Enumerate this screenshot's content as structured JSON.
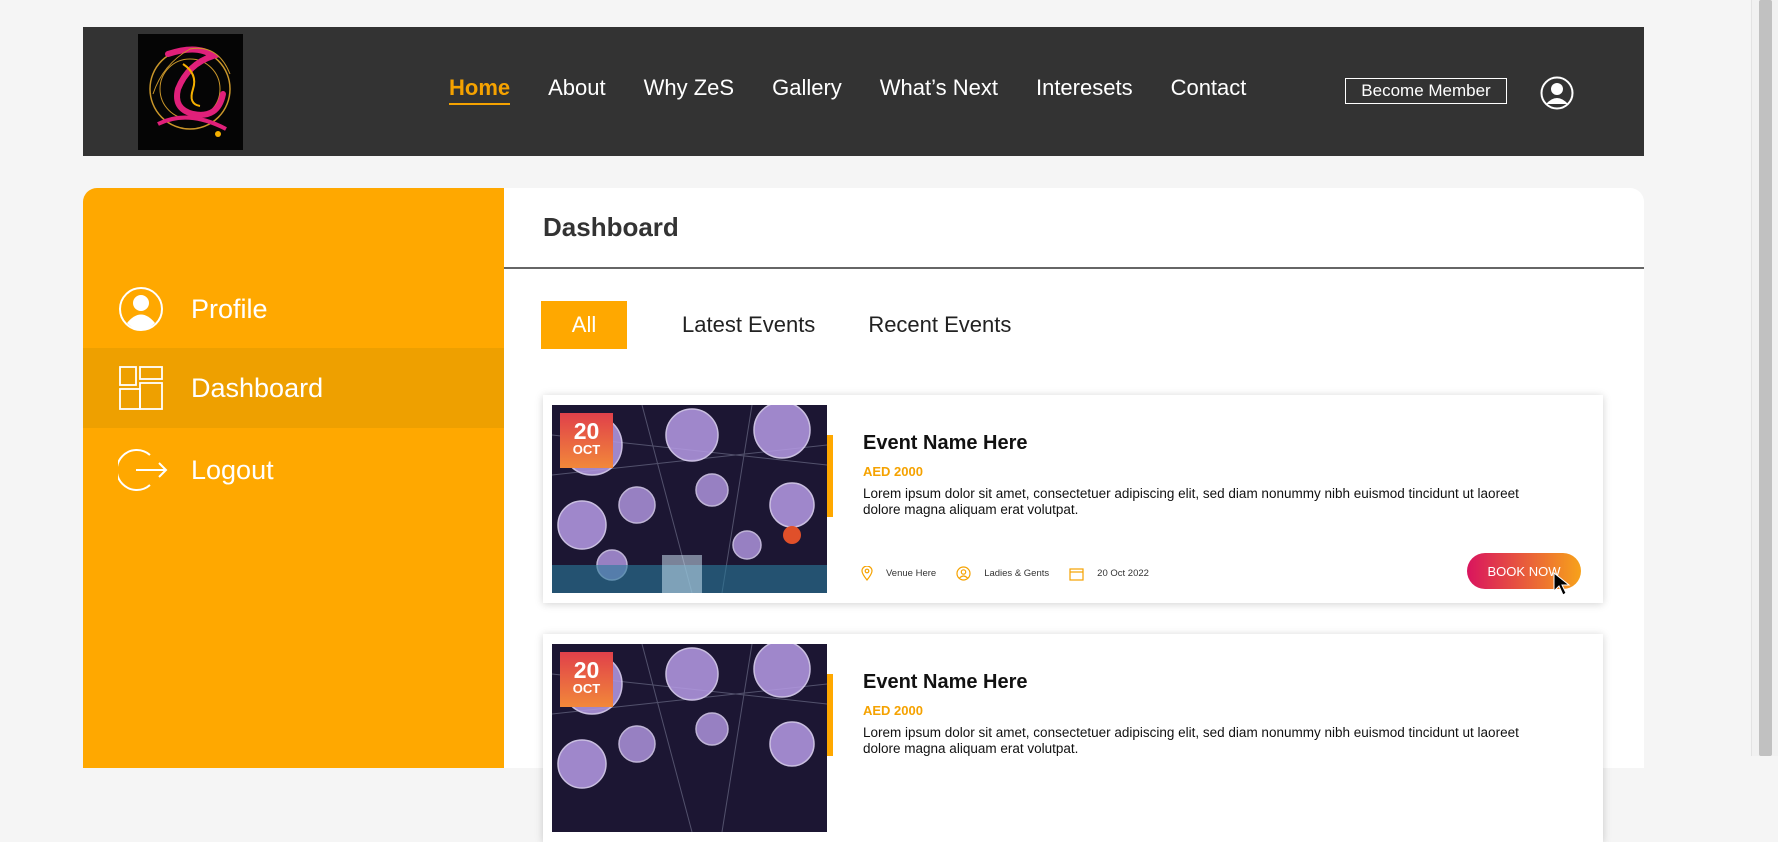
{
  "header": {
    "nav": [
      "Home",
      "About",
      "Why ZeS",
      "Gallery",
      "What’s Next",
      "Interesets",
      "Contact"
    ],
    "active_nav": "Home",
    "become_member": "Become Member"
  },
  "sidebar": {
    "items": [
      {
        "label": "Profile",
        "icon": "user-circle-icon"
      },
      {
        "label": "Dashboard",
        "icon": "dashboard-icon"
      },
      {
        "label": "Logout",
        "icon": "logout-icon"
      }
    ],
    "active": "Dashboard"
  },
  "main": {
    "title": "Dashboard",
    "tabs": [
      "All",
      "Latest Events",
      "Recent Events"
    ],
    "active_tab": "All",
    "events": [
      {
        "day": "20",
        "month": "OCT",
        "name": "Event Name Here",
        "price": "AED 2000",
        "description": "Lorem ipsum dolor sit amet, consectetuer adipiscing elit, sed diam nonummy nibh euismod tincidunt ut laoreet dolore magna aliquam erat volutpat.",
        "venue": "Venue Here",
        "audience": "Ladies & Gents",
        "date": "20 Oct 2022",
        "book": "BOOK NOW"
      },
      {
        "day": "20",
        "month": "OCT",
        "name": "Event Name Here",
        "price": "AED 2000",
        "description": "Lorem ipsum dolor sit amet, consectetuer adipiscing elit, sed diam nonummy nibh euismod tincidunt ut laoreet dolore magna aliquam erat volutpat."
      }
    ]
  },
  "colors": {
    "accent": "#ffa800",
    "topbar": "#333333",
    "book_gradient_start": "#d9145e",
    "book_gradient_end": "#f7a21a"
  }
}
